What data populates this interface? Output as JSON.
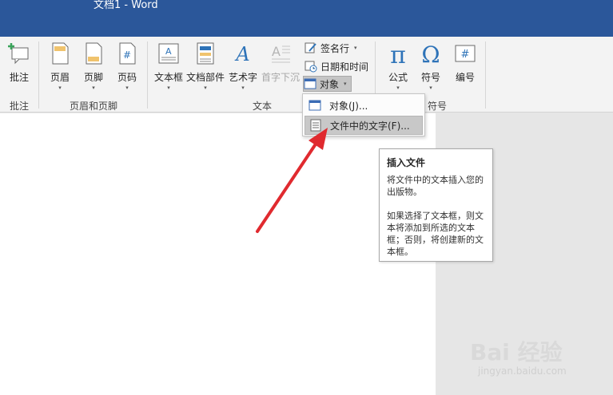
{
  "window": {
    "title": "文档1 - Word"
  },
  "ribbon": {
    "groups": {
      "comments": "批注",
      "header_footer": "页眉和页脚",
      "text": "文本",
      "symbols_partial": "符号"
    },
    "buttons": {
      "comment": "批注",
      "header": "页眉",
      "footer": "页脚",
      "page_number": "页码",
      "text_box": "文本框",
      "quick_parts": "文档部件",
      "wordart": "艺术字",
      "drop_cap": "首字下沉",
      "signature_line": "签名行",
      "date_time": "日期和时间",
      "object": "对象",
      "equation": "公式",
      "symbol": "符号",
      "number": "编号"
    },
    "icons": {
      "equation_glyph": "π",
      "symbol_glyph": "Ω",
      "page_number_glyph": "#",
      "number_glyph": "#",
      "wordart_glyph": "A",
      "dropdown_glyph": "▾"
    }
  },
  "object_menu": {
    "items": [
      {
        "label": "对象(J)..."
      },
      {
        "label": "文件中的文字(F)..."
      }
    ]
  },
  "tooltip": {
    "title": "插入文件",
    "line1": "将文件中的文本插入您的出版物。",
    "line2": "如果选择了文本框，则文本将添加到所选的文本框；否则，将创建新的文本框。"
  },
  "watermark": {
    "brand": "Bai 经验",
    "url": "jingyan.baidu.com"
  },
  "colors": {
    "titlebar": "#2b579a",
    "annotation_arrow": "#e02a2f",
    "equation_icon": "#2e73b8"
  }
}
